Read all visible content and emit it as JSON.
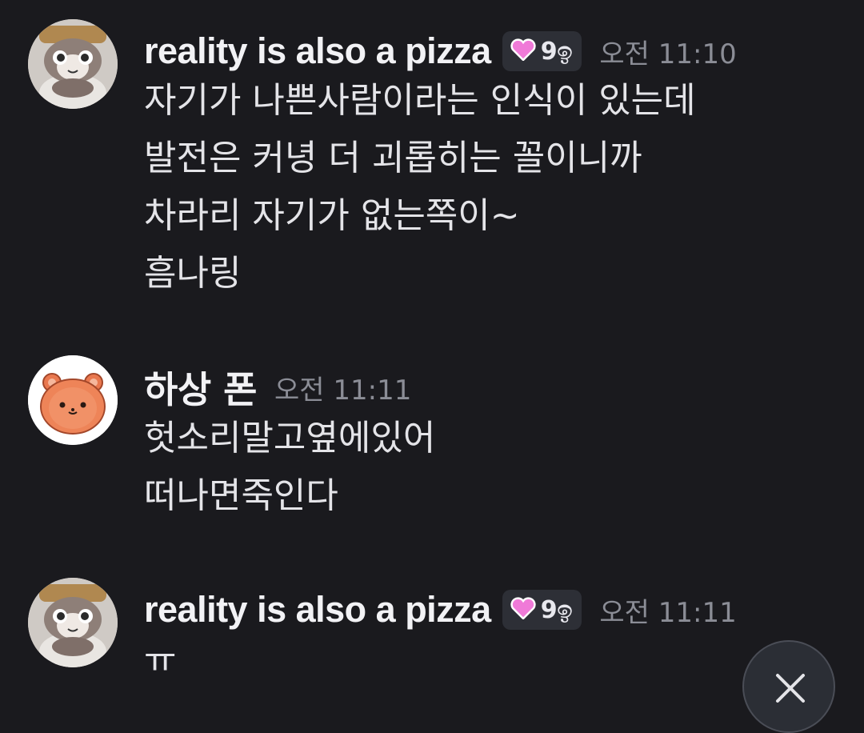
{
  "messages": [
    {
      "author": "reality is also a pizza",
      "avatar_icon": "cat-plush-avatar",
      "badge": {
        "icon": "pink-heart-icon",
        "text": "9ඉ"
      },
      "timestamp": "오전 11:10",
      "lines": [
        "자기가 나쁜사람이라는 인식이 있는데",
        "발전은 커녕 더 괴롭히는 꼴이니까",
        "차라리 자기가 없는쪽이~",
        "흠나링"
      ]
    },
    {
      "author": "하상 폰",
      "avatar_icon": "hamster-avatar",
      "timestamp": "오전 11:11",
      "lines": [
        "헛소리말고옆에있어",
        "떠나면죽인다"
      ]
    },
    {
      "author": "reality is also a pizza",
      "avatar_icon": "cat-plush-avatar",
      "badge": {
        "icon": "pink-heart-icon",
        "text": "9ඉ"
      },
      "timestamp": "오전 11:11",
      "lines": [
        "ㅠ"
      ]
    }
  ],
  "close_button": {
    "icon": "close-icon"
  },
  "colors": {
    "background": "#1a1a1e",
    "text": "#e4e4e8",
    "timestamp": "#8b8d96",
    "badge_bg": "#2d2f36",
    "heart": "#f07ad8"
  }
}
